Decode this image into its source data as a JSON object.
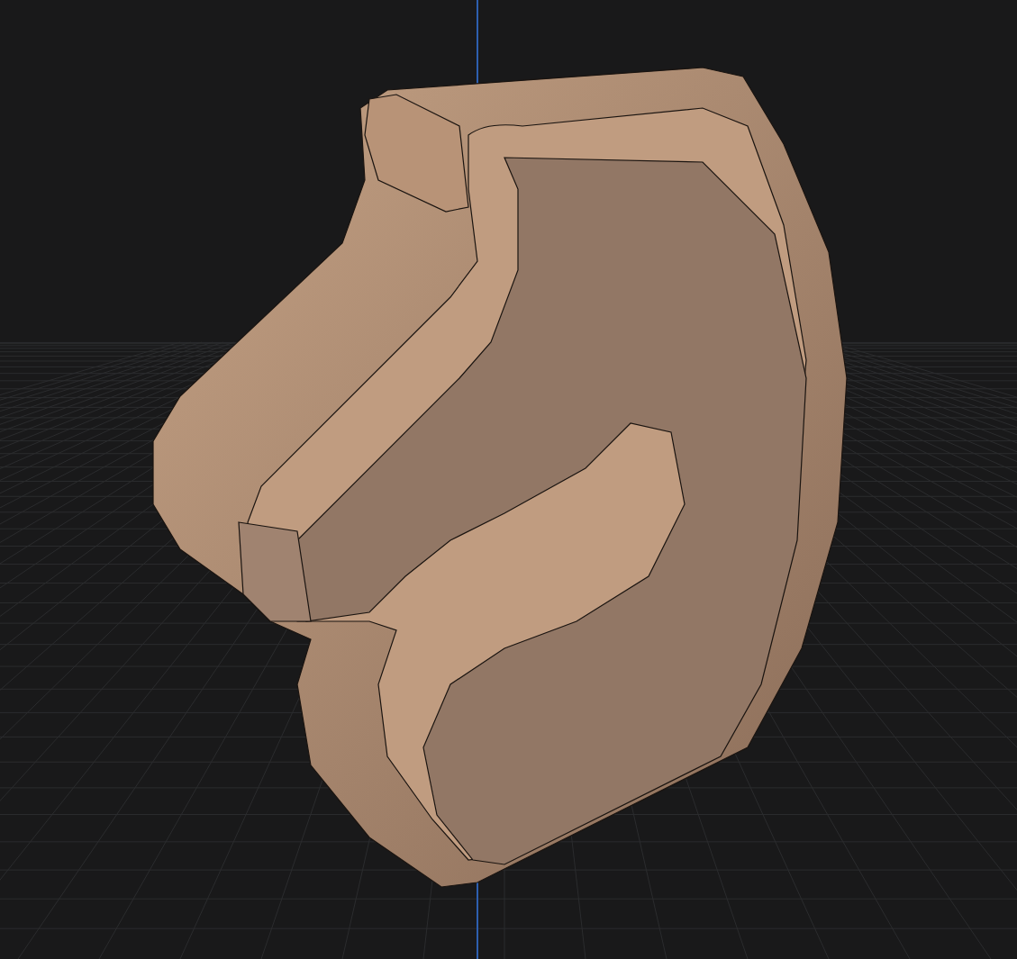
{
  "viewport": {
    "grid_visible": true,
    "axis_visible": true
  }
}
